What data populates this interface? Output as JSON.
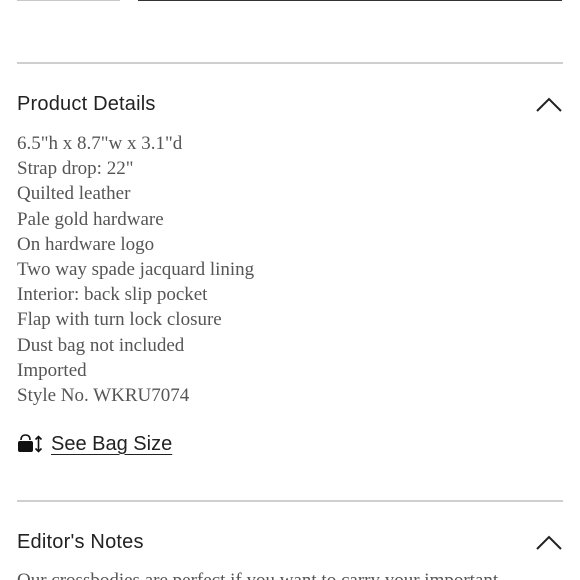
{
  "product_details": {
    "title": "Product Details",
    "toggle_icon": "chevron-up-icon",
    "items": [
      "6.5\"h x 8.7\"w x 3.1\"d",
      "Strap drop: 22\"",
      "Quilted leather",
      "Pale gold hardware",
      "On hardware logo",
      "Two way spade jacquard lining",
      "Interior: back slip pocket",
      "Flap with turn lock closure",
      "Dust bag not included",
      "Imported",
      "Style No. WKRU7074"
    ],
    "bag_size_icon": "bag-size-icon",
    "bag_size_label": "See Bag Size"
  },
  "editors_notes": {
    "title": "Editor's Notes",
    "toggle_icon": "chevron-up-icon",
    "body_visible": "Our crossbodies are perfect if you want to carry your important"
  },
  "colors": {
    "divider": "#cfcfcf",
    "heading_text": "#222222",
    "body_text": "#555555"
  }
}
